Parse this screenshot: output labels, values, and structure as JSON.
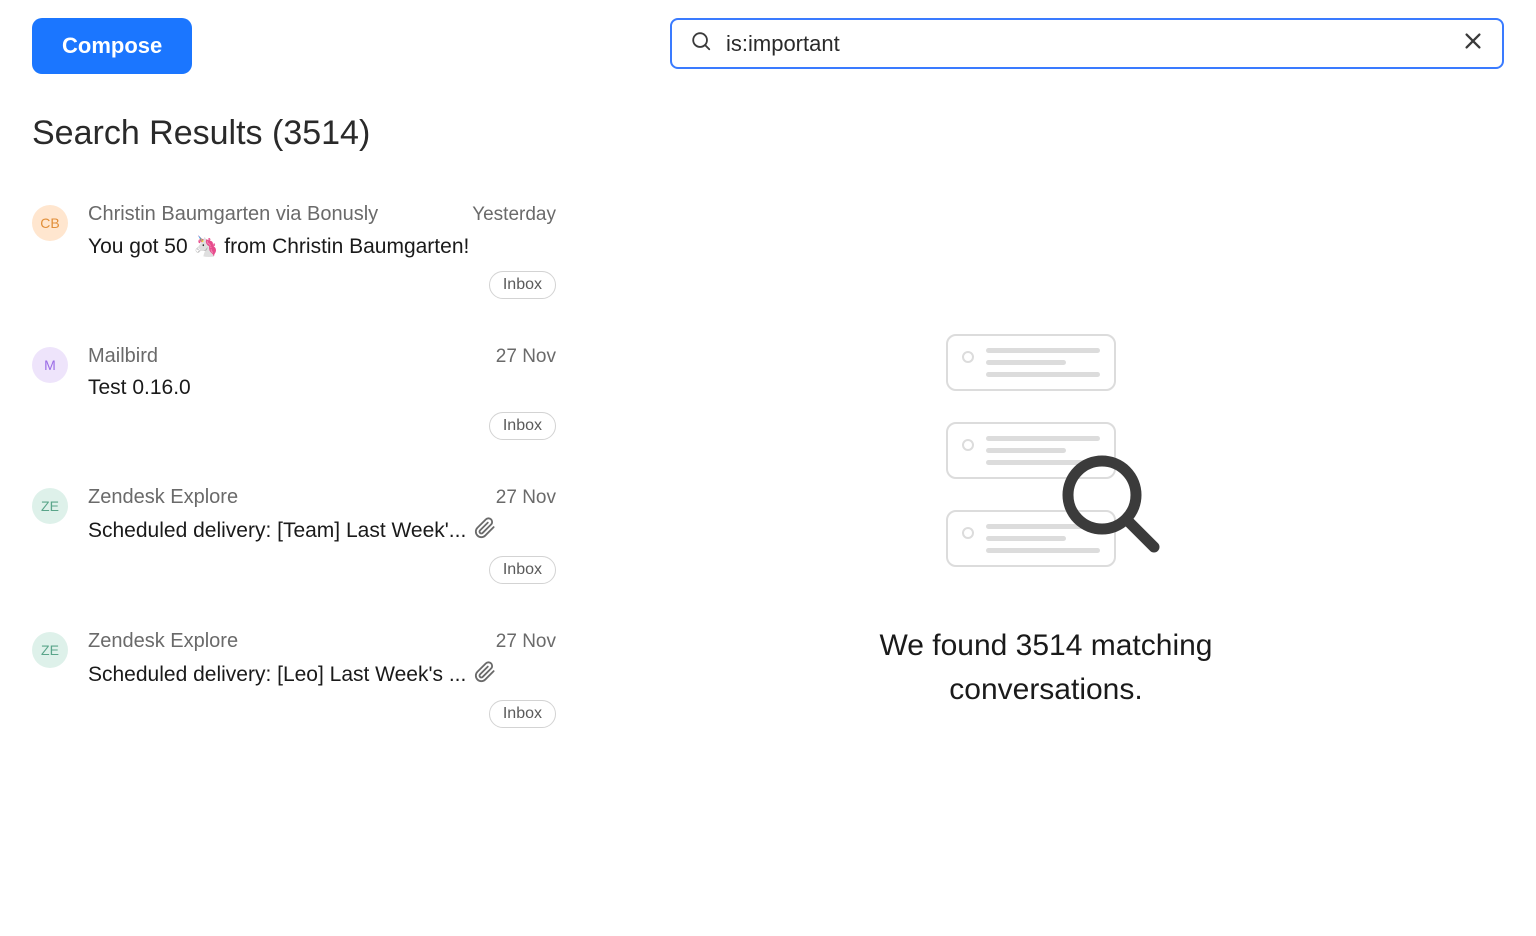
{
  "header": {
    "compose_label": "Compose"
  },
  "search": {
    "value": "is:important"
  },
  "results": {
    "title": "Search Results (3514)",
    "count": 3514,
    "empty_text_line1": "We found 3514 matching",
    "empty_text_line2": "conversations.",
    "items": [
      {
        "avatar_initials": "CB",
        "avatar_bg": "#ffe6cf",
        "avatar_fg": "#e18f3a",
        "sender": "Christin Baumgarten via Bonusly",
        "date": "Yesterday",
        "subject_before": "You got 50 ",
        "emoji": "🦄",
        "subject_after": " from Christin Baumgarten!",
        "has_attachment": false,
        "label": "Inbox"
      },
      {
        "avatar_initials": "M",
        "avatar_bg": "#eee4fb",
        "avatar_fg": "#9a6be6",
        "sender": "Mailbird",
        "date": "27 Nov",
        "subject_before": "Test 0.16.0",
        "emoji": "",
        "subject_after": "",
        "has_attachment": false,
        "label": "Inbox"
      },
      {
        "avatar_initials": "ZE",
        "avatar_bg": "#def1ea",
        "avatar_fg": "#5aa58a",
        "sender": "Zendesk Explore",
        "date": "27 Nov",
        "subject_before": "Scheduled delivery: [Team] Last Week'...",
        "emoji": "",
        "subject_after": "",
        "has_attachment": true,
        "label": "Inbox"
      },
      {
        "avatar_initials": "ZE",
        "avatar_bg": "#def1ea",
        "avatar_fg": "#5aa58a",
        "sender": "Zendesk Explore",
        "date": "27 Nov",
        "subject_before": "Scheduled delivery: [Leo] Last Week's ...",
        "emoji": "",
        "subject_after": "",
        "has_attachment": true,
        "label": "Inbox"
      }
    ]
  }
}
